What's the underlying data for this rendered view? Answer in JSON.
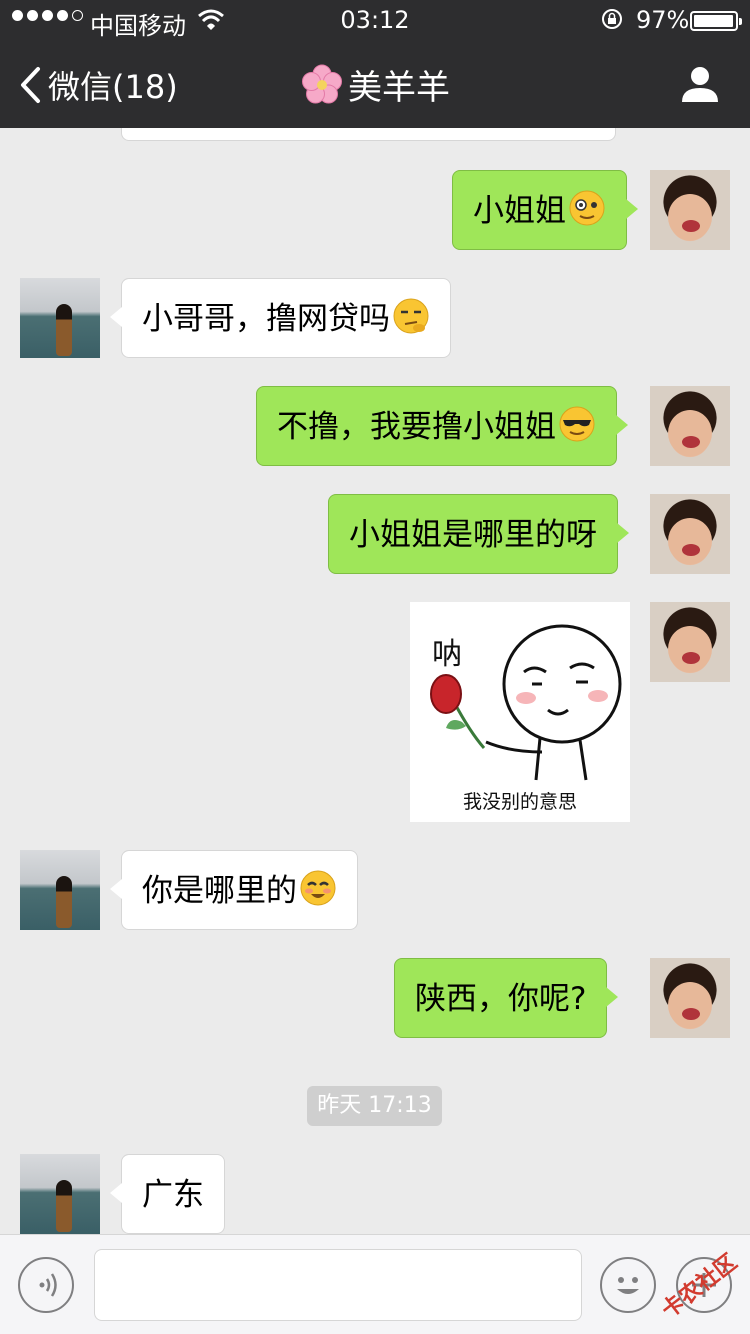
{
  "status_bar": {
    "carrier": "中国移动",
    "time": "03:12",
    "battery": "97%",
    "battery_level": 0.97,
    "signal_bars": 4,
    "signal_total": 5
  },
  "nav": {
    "back_label": "微信(18)",
    "title": "美羊羊",
    "title_icon": "cherry-blossom-icon",
    "right_icon": "profile-icon"
  },
  "messages": [
    {
      "sender": "self",
      "text": "小姐姐",
      "emoji": "monocle-face-icon"
    },
    {
      "sender": "other",
      "text": "小哥哥，撸网贷吗",
      "emoji": "thinking-face-icon"
    },
    {
      "sender": "self",
      "text": "不撸，我要撸小姐姐",
      "emoji": "sunglasses-face-icon"
    },
    {
      "sender": "self",
      "text": "小姐姐是哪里的呀",
      "emoji": ""
    },
    {
      "sender": "self",
      "type": "sticker",
      "caption": "我没别的意思",
      "sticker_word": "呐"
    },
    {
      "sender": "other",
      "text": "你是哪里的",
      "emoji": "grinning-face-icon"
    },
    {
      "sender": "self",
      "text": "陕西，你呢?",
      "emoji": ""
    },
    {
      "type": "timestamp",
      "text": "昨天 17:13"
    },
    {
      "sender": "other",
      "text": "广东",
      "emoji": ""
    }
  ],
  "input_bar": {
    "value": "",
    "placeholder": "",
    "left_icon": "voice-icon",
    "emoji_icon": "emoji-icon",
    "plus_icon": "plus-icon"
  },
  "watermark": "卡农社区",
  "colors": {
    "nav_bg": "#2d2d2f",
    "chat_bg": "#ebebeb",
    "bubble_self": "#9fe659",
    "bubble_other": "#ffffff"
  }
}
